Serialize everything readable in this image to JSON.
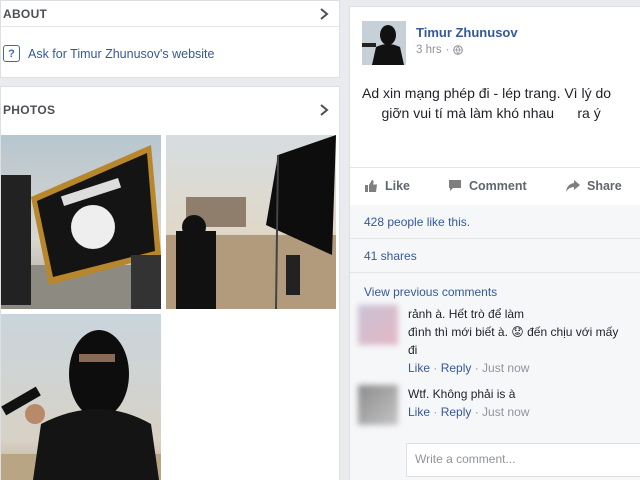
{
  "about": {
    "title": "ABOUT",
    "link": "Ask for Timur Zhunusov's website"
  },
  "photos": {
    "title": "PHOTOS"
  },
  "post": {
    "author": "Timur Zhunusov",
    "time": "3 hrs",
    "privacy_sep": "·",
    "text_line1": "Ad xin mạng phép đi - lép trang. Vì lý do",
    "text_line2": "     giỡn vui tí mà làm khó nhau      ra ý",
    "actions": {
      "like": "Like",
      "comment": "Comment",
      "share": "Share"
    },
    "likes": "428 people like this.",
    "shares": "41 shares",
    "view_previous": "View previous comments"
  },
  "comments": [
    {
      "line1": "              rảnh à. Hết trò để làm",
      "line2": "đình thì mới biết à. 😟 đến chịu với mấy",
      "line3": "đi",
      "like": "Like",
      "reply": "Reply",
      "time": "Just now"
    },
    {
      "line1": "        Wtf. Không phải is à",
      "like": "Like",
      "reply": "Reply",
      "time": "Just now"
    }
  ],
  "write_comment": {
    "placeholder": "Write a comment..."
  },
  "colors": {
    "link": "#365899",
    "background": "#e9ebee",
    "flag": "#111111",
    "fringe": "#b8862b"
  }
}
